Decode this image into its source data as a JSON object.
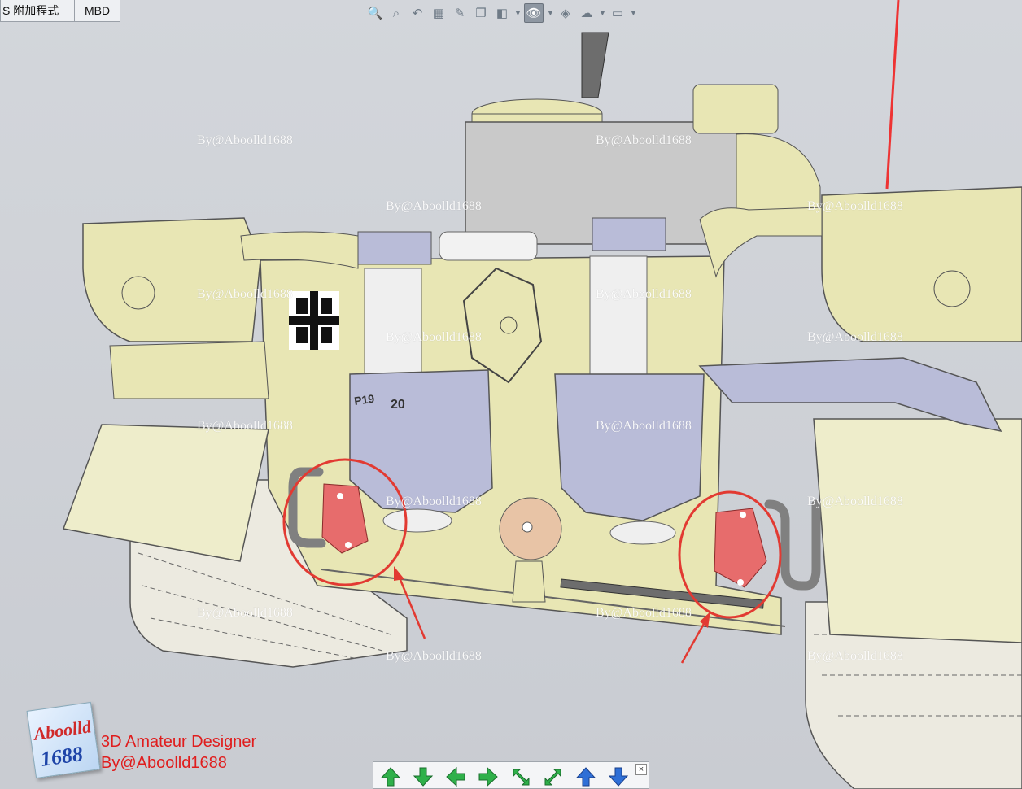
{
  "tabs": [
    "S 附加程式",
    "MBD"
  ],
  "hud": {
    "items": [
      {
        "name": "zoom-to-fit-icon",
        "glyph": "🔍"
      },
      {
        "name": "zoom-area-icon",
        "glyph": "⌕"
      },
      {
        "name": "previous-view-icon",
        "glyph": "↶"
      },
      {
        "name": "section-view-icon",
        "glyph": "▦"
      },
      {
        "name": "dynamic-annotation-icon",
        "glyph": "✎"
      },
      {
        "name": "view-orientation-icon",
        "glyph": "❐"
      },
      {
        "name": "display-style-icon",
        "glyph": "◧"
      },
      {
        "name": "hide-show-items-icon",
        "glyph": "👁"
      },
      {
        "name": "edit-appearance-icon",
        "glyph": "◈"
      },
      {
        "name": "apply-scene-icon",
        "glyph": "☁"
      },
      {
        "name": "view-settings-icon",
        "glyph": "▭"
      }
    ]
  },
  "watermark": "By@Aboolld1688",
  "logo": {
    "top": "Aboolld",
    "bottom": "1688"
  },
  "credits": [
    "3D Amateur Designer",
    "By@Aboolld1688"
  ],
  "nav": {
    "buttons": [
      "rotate-up-icon",
      "rotate-down-icon",
      "rotate-left-icon",
      "rotate-right-icon",
      "roll-clockwise-icon",
      "roll-counterclockwise-icon",
      "move-up-icon",
      "move-down-icon"
    ],
    "close": "×"
  },
  "model": {
    "hull_color": "#e8e6b4",
    "steel_color": "#b9bcd8",
    "highlight_color": "#e23a32",
    "cap_color": "#e76c6c",
    "markings": [
      "P19",
      "20"
    ]
  }
}
